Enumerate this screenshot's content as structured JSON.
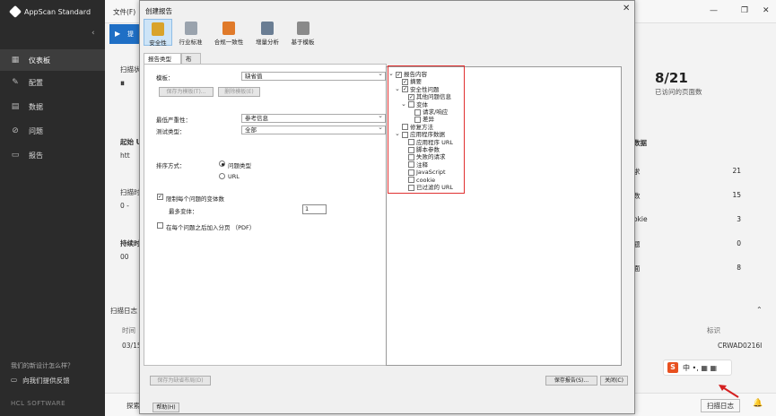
{
  "app": {
    "brand": "AppScan Standard",
    "file_menu": "文件(F)",
    "window_controls": [
      "—",
      "❐",
      "✕"
    ],
    "sidebar": {
      "items": [
        {
          "icon": "dashboard-icon",
          "glyph": "▦",
          "label": "仪表板",
          "active": true
        },
        {
          "icon": "wrench-icon",
          "glyph": "✎",
          "label": "配置",
          "active": false
        },
        {
          "icon": "data-icon",
          "glyph": "▤",
          "label": "数据",
          "active": false
        },
        {
          "icon": "issue-icon",
          "glyph": "⊘",
          "label": "问题",
          "active": false
        },
        {
          "icon": "report-icon",
          "glyph": "▭",
          "label": "报告",
          "active": false
        }
      ],
      "feedback_question": "我们的新设计怎么样？",
      "feedback_label": "向我们提供反馈",
      "footer": "HCL SOFTWARE"
    },
    "background": {
      "scan_label": "扫描状",
      "scan_btn": "提",
      "start_label": "起始 U",
      "start_sub": "htt",
      "scan_pos": "扫描时",
      "warn_val": "0 -",
      "duration": "持续时",
      "duration_val": "00",
      "scan_log": "扫描日志",
      "log_time": "时间",
      "log_date": "03/15",
      "log_id_header": "标识",
      "log_id": "CRWAD0216I",
      "pages_count": "8/21",
      "pages_label": "已访问的页面数",
      "data_header": "数据",
      "stats": [
        {
          "label": "求",
          "value": "21"
        },
        {
          "label": "数",
          "value": "15"
        },
        {
          "label": "okie",
          "value": "3"
        },
        {
          "label": "题",
          "value": "0"
        },
        {
          "label": "面",
          "value": "8"
        }
      ],
      "status_left": "探索仓",
      "status_right_btn": "扫描日志"
    },
    "ime_text": "中 •, ▦ ▦"
  },
  "dialog": {
    "title": "创建报告",
    "toolbar": [
      {
        "label": "安全性",
        "active": true,
        "icon": "lock-icon",
        "color": "#d9a32b"
      },
      {
        "label": "行业标准",
        "active": false,
        "icon": "industry-icon",
        "color": "#9aa3ad"
      },
      {
        "label": "合规一致性",
        "active": false,
        "icon": "compliance-icon",
        "color": "#e07a2a"
      },
      {
        "label": "增量分析",
        "active": false,
        "icon": "delta-icon",
        "color": "#6a7d93"
      },
      {
        "label": "基于模板",
        "active": false,
        "icon": "template-icon",
        "color": "#8a8a8a"
      }
    ],
    "tabs": [
      "报告类型",
      "布局"
    ],
    "form": {
      "template_label": "模板：",
      "template_value": "缺省值",
      "save_template_btn": "保存为模板(T)...",
      "delete_template_btn": "删除模板(E)",
      "min_severity_label": "最低严重性：",
      "min_severity_value": "参考信息",
      "test_type_label": "测试类型：",
      "test_type_value": "全部",
      "sort_label": "排序方式：",
      "sort_options": [
        {
          "label": "问题类型",
          "selected": true
        },
        {
          "label": "URL",
          "selected": false
        }
      ],
      "limit_variants_label": "限制每个问题的变体数",
      "limit_variants_checked": true,
      "max_variants_label": "最多变体：",
      "max_variants_value": "1",
      "page_break_label": "在每个问题之后加入分页 （PDF）",
      "page_break_checked": false
    },
    "tree": [
      {
        "label": "报告内容",
        "level": 0,
        "checked": true,
        "expander": "⌄"
      },
      {
        "label": "摘要",
        "level": 1,
        "checked": true,
        "expander": ""
      },
      {
        "label": "安全性问题",
        "level": 1,
        "checked": true,
        "expander": "⌄"
      },
      {
        "label": "其他问题信息",
        "level": 2,
        "checked": true,
        "expander": ""
      },
      {
        "label": "变体",
        "level": 2,
        "checked": false,
        "expander": "⌄"
      },
      {
        "label": "请求/响应",
        "level": 3,
        "checked": false,
        "expander": ""
      },
      {
        "label": "差异",
        "level": 3,
        "checked": false,
        "expander": ""
      },
      {
        "label": "修复方法",
        "level": 1,
        "checked": false,
        "expander": ""
      },
      {
        "label": "应用程序数据",
        "level": 1,
        "checked": false,
        "expander": "⌄"
      },
      {
        "label": "应用程序 URL",
        "level": 2,
        "checked": false,
        "expander": ""
      },
      {
        "label": "脚本参数",
        "level": 2,
        "checked": false,
        "expander": ""
      },
      {
        "label": "失败的请求",
        "level": 2,
        "checked": false,
        "expander": ""
      },
      {
        "label": "注释",
        "level": 2,
        "checked": false,
        "expander": ""
      },
      {
        "label": "JavaScript",
        "level": 2,
        "checked": false,
        "expander": ""
      },
      {
        "label": "cookie",
        "level": 2,
        "checked": false,
        "expander": ""
      },
      {
        "label": "已过滤的 URL",
        "level": 2,
        "checked": false,
        "expander": ""
      }
    ],
    "buttons": {
      "save_as_default": "保存为缺省布局(D)",
      "save_report": "保存报告(S)...",
      "close": "关闭(C)",
      "help": "帮助(H)"
    },
    "close_glyph": "✕",
    "accent_highlight": "#e03030"
  }
}
